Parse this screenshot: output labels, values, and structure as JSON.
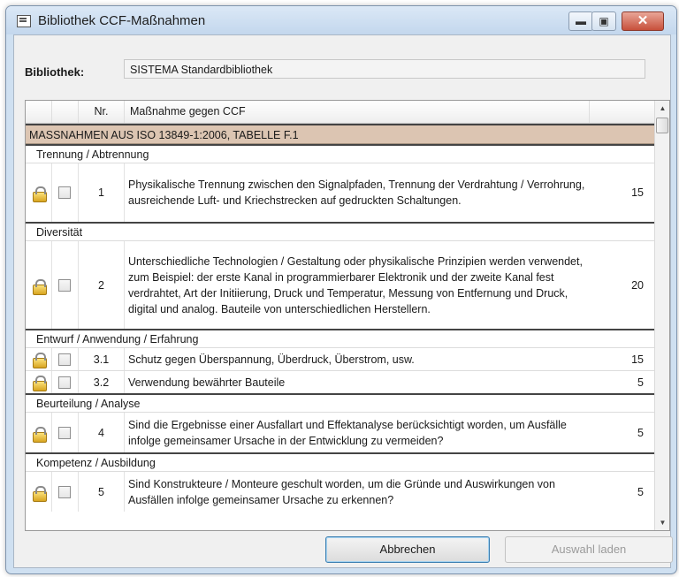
{
  "window": {
    "title": "Bibliothek CCF-Maßnahmen",
    "min_icon": "minimize-icon",
    "max_icon": "maximize-icon",
    "close_icon": "close-icon"
  },
  "library": {
    "label": "Bibliothek:",
    "value": "SISTEMA Standardbibliothek"
  },
  "table": {
    "columns": {
      "nr": "Nr.",
      "measure": "Maßnahme gegen CCF"
    },
    "section": "MASSNAHMEN AUS ISO 13849-1:2006, TABELLE F.1",
    "groups": [
      {
        "name": "Trennung / Abtrennung",
        "items": [
          {
            "nr": "1",
            "text": "Physikalische Trennung zwischen den Signalpfaden, Trennung der Verdrahtung / Verrohrung, ausreichende Luft- und Kriechstrecken auf gedruckten Schaltungen.",
            "points": "15"
          }
        ]
      },
      {
        "name": "Diversität",
        "items": [
          {
            "nr": "2",
            "text": "Unterschiedliche Technologien / Gestaltung oder physikalische Prinzipien werden verwendet, zum Beispiel: der erste Kanal in programmierbarer Elektronik und der zweite Kanal fest verdrahtet, Art der Initiierung, Druck und Temperatur, Messung von Entfernung und Druck, digital und analog. Bauteile von unterschiedlichen Herstellern.",
            "points": "20"
          }
        ]
      },
      {
        "name": "Entwurf / Anwendung / Erfahrung",
        "items": [
          {
            "nr": "3.1",
            "text": "Schutz gegen Überspannung, Überdruck, Überstrom, usw.",
            "points": "15"
          },
          {
            "nr": "3.2",
            "text": "Verwendung bewährter Bauteile",
            "points": "5"
          }
        ]
      },
      {
        "name": "Beurteilung / Analyse",
        "items": [
          {
            "nr": "4",
            "text": "Sind die Ergebnisse einer Ausfallart und Effektanalyse berücksichtigt worden, um Ausfälle infolge gemeinsamer Ursache in der Entwicklung zu vermeiden?",
            "points": "5"
          }
        ]
      },
      {
        "name": "Kompetenz / Ausbildung",
        "items": [
          {
            "nr": "5",
            "text": "Sind Konstrukteure / Monteure geschult worden, um die Gründe und Auswirkungen von Ausfällen infolge gemeinsamer Ursache zu erkennen?",
            "points": "5"
          }
        ]
      }
    ]
  },
  "buttons": {
    "cancel": "Abbrechen",
    "load": "Auswahl laden"
  },
  "colors": {
    "section_bg": "#dcc5b2",
    "titlebar": "#c3d7ed",
    "lock": "#d8a520"
  }
}
